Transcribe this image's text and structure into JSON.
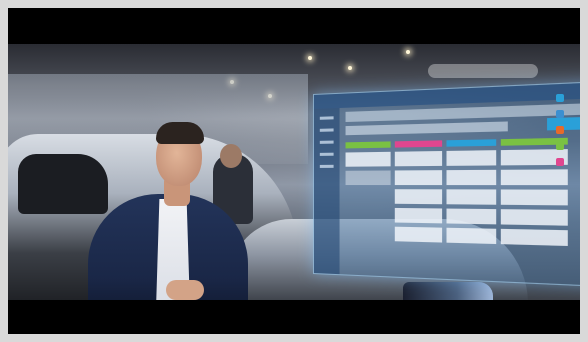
{
  "scene": {
    "description_tags": [
      "presenter",
      "car-showroom",
      "holographic-dashboard"
    ]
  },
  "colors": {
    "accent_green": "#7ac143",
    "accent_pink": "#e0468f",
    "accent_blue": "#2aa0d8",
    "hologram": "#4678aa"
  }
}
